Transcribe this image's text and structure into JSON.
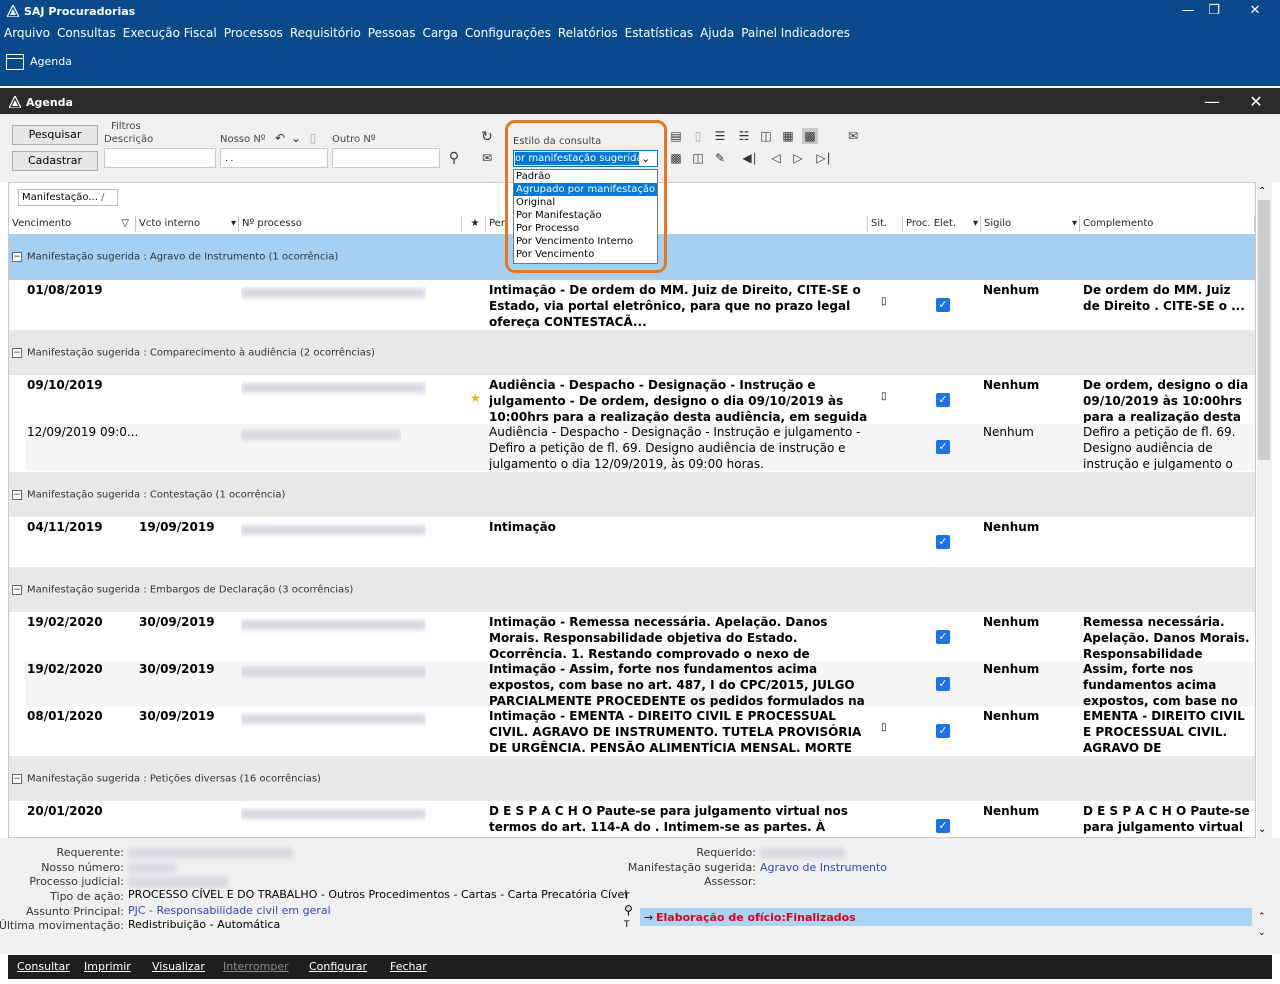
{
  "app": {
    "title": "SAJ Procuradorias"
  },
  "menu": [
    "Arquivo",
    "Consultas",
    "Execução Fiscal",
    "Processos",
    "Requisitório",
    "Pessoas",
    "Carga",
    "Configurações",
    "Relatórios",
    "Estatísticas",
    "Ajuda",
    "Painel Indicadores"
  ],
  "toolbar": {
    "agenda_label": "Agenda"
  },
  "child_window": {
    "title": "Agenda"
  },
  "filters": {
    "section_label": "Filtros",
    "search_button": "Pesquisar",
    "register_button": "Cadastrar",
    "descricao_label": "Descrição",
    "descricao_value": "",
    "nosso_label": "Nosso Nº",
    "nosso_value": ". .",
    "outro_label": "Outro Nº",
    "outro_value": ""
  },
  "query_style": {
    "label": "Estilo da consulta",
    "selected": "or manifestação sugerida",
    "options": [
      "Padrão",
      "Agrupado por manifestação s",
      "Original",
      "Por Manifestação",
      "Por Processo",
      "Por Vencimento Interno",
      "Por Vencimento"
    ],
    "highlighted_index": 1
  },
  "grid": {
    "group_by_chip": "Manifestação...",
    "columns": [
      "Vencimento",
      "Vcto interno",
      "Nº processo",
      "★",
      "Pen",
      "Sit.",
      "Proc. Elet.",
      "Sigilo",
      "Complemento"
    ],
    "groups": [
      {
        "label": "Manifestação sugerida : Agravo de Instrumento (1 ocorrência)",
        "selected": true
      },
      {
        "label": "Manifestação sugerida : Comparecimento à audiência (2 ocorrências)"
      },
      {
        "label": "Manifestação sugerida : Contestação (1 ocorrência)"
      },
      {
        "label": "Manifestação sugerida : Embargos de Declaração (3 ocorrências)"
      },
      {
        "label": "Manifestação sugerida : Petições diversas (16 ocorrências)"
      }
    ],
    "rows": [
      {
        "venc": "01/08/2019",
        "vcto": "",
        "pend": "Intimação - De ordem do MM. Juiz de Direito, CITE-SE o Estado, via portal eletrônico, para que no prazo legal ofereça CONTESTACÃ...",
        "sigilo": "Nenhum",
        "compl": "De ordem do MM. Juiz de Direito . CITE-SE o ..."
      },
      {
        "venc": "09/10/2019",
        "vcto": "",
        "pend": "Audiência - Despacho - Designação - Instrução e julgamento - De ordem, designo o dia 09/10/2019 às 10:00hrs para a realização desta audiência, em seguida ...",
        "sigilo": "Nenhum",
        "compl": "De ordem, designo o dia 09/10/2019 às 10:00hrs para a realização desta ..."
      },
      {
        "venc": "12/09/2019 09:0...",
        "vcto": "",
        "pend": "Audiência - Despacho - Designação - Instrução e julgamento - Defiro a petição de fl. 69. Designo audiência de instrução e julgamento o dia 12/09/2019, às 09:00 horas.",
        "sigilo": "Nenhum",
        "compl": "Defiro a petição de fl. 69. Designo audiência de instrução e julgamento o di..."
      },
      {
        "venc": "04/11/2019",
        "vcto": "19/09/2019",
        "pend": "Intimação",
        "sigilo": "Nenhum",
        "compl": ""
      },
      {
        "venc": "19/02/2020",
        "vcto": "30/09/2019",
        "pend": "Intimação - Remessa necessária. Apelação. Danos Morais. Responsabilidade objetiva do Estado. Ocorrência. 1. Restando comprovado o nexo de causalidade entre o fa...",
        "sigilo": "Nenhum",
        "compl": "Remessa necessária. Apelação. Danos Morais. Responsabilidade objeti..."
      },
      {
        "venc": "19/02/2020",
        "vcto": "30/09/2019",
        "pend": "Intimação - Assim, forte nos fundamentos acima expostos, com base no art. 487, I do CPC/2015, JULGO PARCIALMENTE PROCEDENTE os pedidos formulados na ini...",
        "sigilo": "Nenhum",
        "compl": "Assim, forte nos fundamentos acima expostos, com base no ..."
      },
      {
        "venc": "08/01/2020",
        "vcto": "30/09/2019",
        "pend": "Intimação - EMENTA - DIREITO CIVIL E PROCESSUAL CIVIL. AGRAVO DE INSTRUMENTO. TUTELA PROVISÓRIA DE URGÊNCIA. PENSÃO ALIMENTÍCIA MENSAL. MORTE DE DET...",
        "sigilo": "Nenhum",
        "compl": "EMENTA - DIREITO CIVIL E PROCESSUAL CIVIL. AGRAVO DE INSTRUMENT..."
      },
      {
        "venc": "20/01/2020",
        "vcto": "",
        "pend": "D E S P A C H O Paute-se para julgamento virtual nos termos do art. 114-A do . Intimem-se as partes. À",
        "sigilo": "Nenhum",
        "compl": "D E S P A C H O Paute-se para julgamento virtual"
      }
    ]
  },
  "details": {
    "requerente_label": "Requerente:",
    "nosso_numero_label": "Nosso número:",
    "processo_judicial_label": "Processo judicial:",
    "tipo_acao_label": "Tipo de ação:",
    "tipo_acao_value": "PROCESSO CÍVEL E DO TRABALHO - Outros Procedimentos - Cartas - Carta Precatória Cível",
    "assunto_label": "Assunto Principal:",
    "assunto_value": "PJC - Responsabilidade civil em geral",
    "ultima_mov_label": "Última movimentação:",
    "ultima_mov_value": "Redistribuição - Automática",
    "requerido_label": "Requerido:",
    "manifestacao_label": "Manifestação sugerida:",
    "manifestacao_value": "Agravo de Instrumento",
    "assessor_label": "Assessor:",
    "movement_text": "Elaboração de ofício:Finalizados"
  },
  "bottom": {
    "consultar": "Consultar",
    "imprimir": "Imprimir",
    "visualizar": "Visualizar",
    "interromper": "Interromper",
    "configurar": "Configurar",
    "fechar": "Fechar"
  },
  "colors": {
    "header_bg": "#0a4a8c",
    "child_bar_bg": "#2b2b2b",
    "selected_group": "#a6d0f2",
    "highlight_ring": "#e8761f",
    "link": "#2c4ab8",
    "movement_text": "#e0001a"
  }
}
